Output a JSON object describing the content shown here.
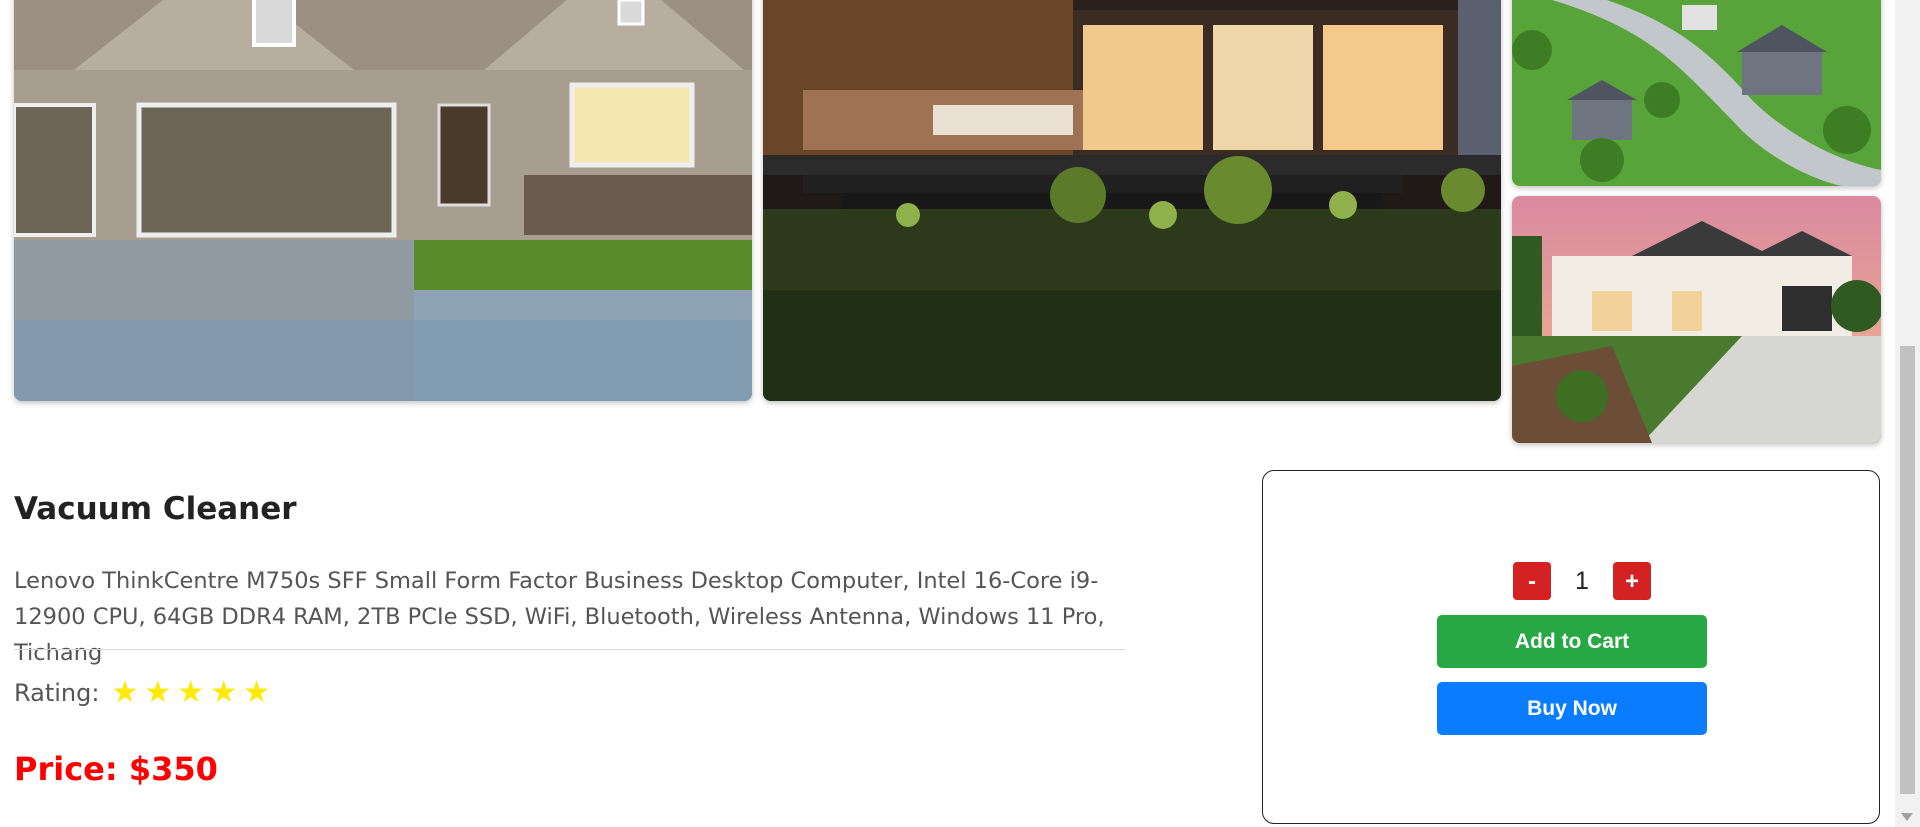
{
  "gallery": {
    "images": [
      {
        "alt": "house-front-with-garage"
      },
      {
        "alt": "modern-house-patio-night"
      },
      {
        "alt": "aerial-suburban-neighborhood"
      },
      {
        "alt": "house-at-sunset-driveway"
      }
    ]
  },
  "product": {
    "title": "Vacuum Cleaner",
    "description": "Lenovo ThinkCentre M750s SFF Small Form Factor Business Desktop Computer, Intel 16-Core i9-12900 CPU, 64GB DDR4 RAM, 2TB PCIe SSD, WiFi, Bluetooth, Wireless Antenna, Windows 11 Pro, Tichang",
    "rating_label": "Rating:",
    "rating_value": 5,
    "star_glyph": "★",
    "price_label": "Price:",
    "price_value": "$350",
    "price_color": "#ff0000"
  },
  "cart": {
    "decrement_label": "-",
    "quantity": "1",
    "increment_label": "+",
    "add_to_cart_label": "Add to Cart",
    "buy_now_label": "Buy Now",
    "add_color": "#28a745",
    "buy_color": "#0a7cff"
  }
}
